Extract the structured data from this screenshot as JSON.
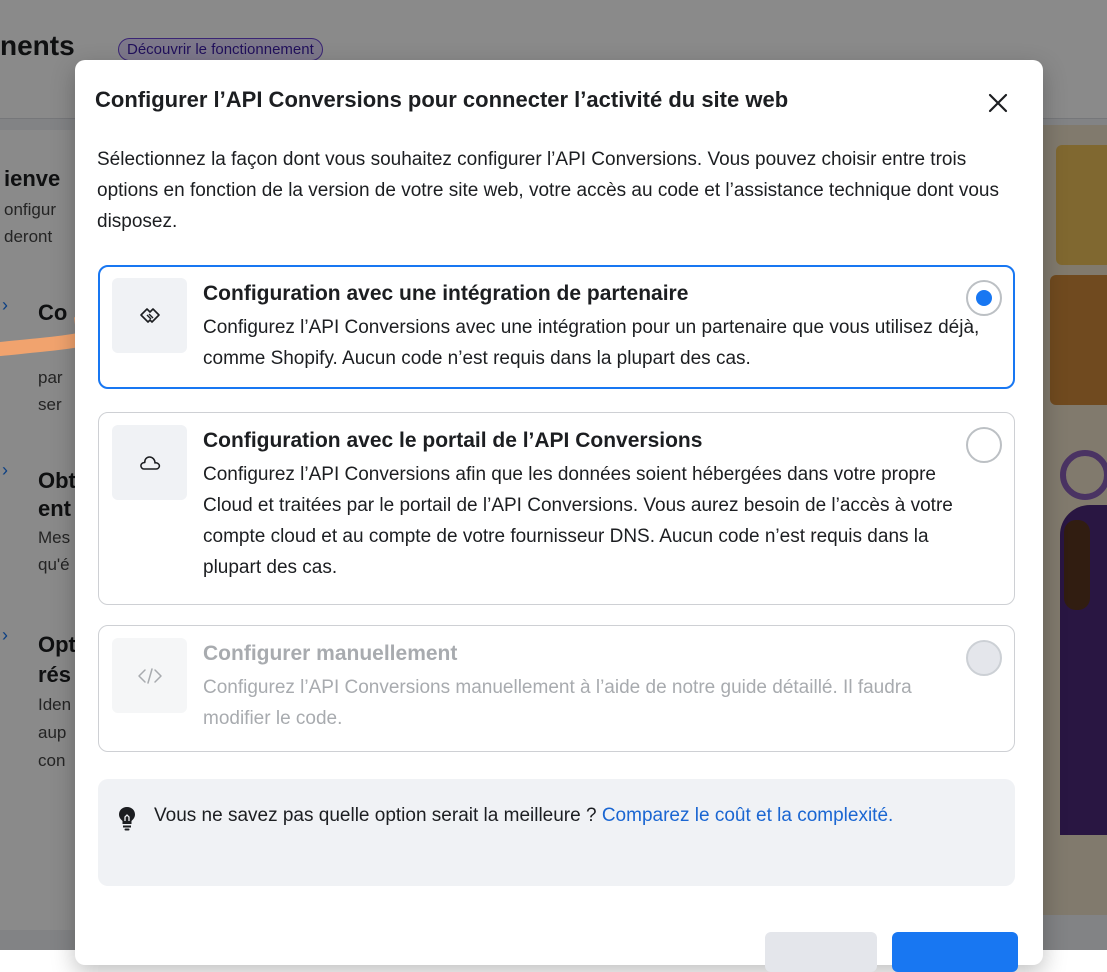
{
  "background": {
    "page_title": "nents",
    "badge": "Découvrir le fonctionnement",
    "left_card": {
      "heading": "ienve",
      "line1": "onfigur",
      "line2": "deront",
      "items": [
        {
          "title": "Co",
          "line1": "par",
          "line2": "ser"
        },
        {
          "title": "Obt",
          "title2": "ent",
          "line1": "Mes",
          "line2": "qu'é"
        },
        {
          "title": "Opt",
          "title2": "rés",
          "line1": "Iden",
          "line2": "aup",
          "line3": "con"
        }
      ]
    }
  },
  "dialog": {
    "title": "Configurer l’API Conversions pour connecter l’activité du site web",
    "description": "Sélectionnez la façon dont vous souhaitez configurer l’API Conversions. Vous pouvez choisir entre trois options en fonction de la version de votre site web, votre accès au code et l’assistance technique dont vous disposez.",
    "options": [
      {
        "icon": "handshake-icon",
        "title": "Configuration avec une intégration de partenaire",
        "description": "Configurez l’API Conversions avec une intégration pour un partenaire que vous utilisez déjà, comme Shopify. Aucun code n’est requis dans la plupart des cas.",
        "state": "selected"
      },
      {
        "icon": "cloud-icon",
        "title": "Configuration avec le portail de l’API Conversions",
        "description": "Configurez l’API Conversions afin que les données soient hébergées dans votre propre Cloud et traitées par le portail de l’API Conversions. Vous aurez besoin de l’accès à votre compte cloud et au compte de votre fournisseur DNS. Aucun code n’est requis dans la plupart des cas.",
        "state": "unselected"
      },
      {
        "icon": "code-icon",
        "title": "Configurer manuellement",
        "description": "Configurez l’API Conversions manuellement à l’aide de notre guide détaillé. Il faudra modifier le code.",
        "state": "disabled"
      }
    ],
    "hint": {
      "icon": "lightbulb-icon",
      "text": "Vous ne savez pas quelle option serait la meilleure ? ",
      "link": "Comparez le coût et la complexité."
    },
    "footer": {
      "left_text": "",
      "secondary_label": "",
      "primary_label": ""
    }
  },
  "colors": {
    "accent": "#1877f2",
    "link": "#1a66d2",
    "arrow": "#f1a36e",
    "badge_bg": "#e7deff"
  }
}
